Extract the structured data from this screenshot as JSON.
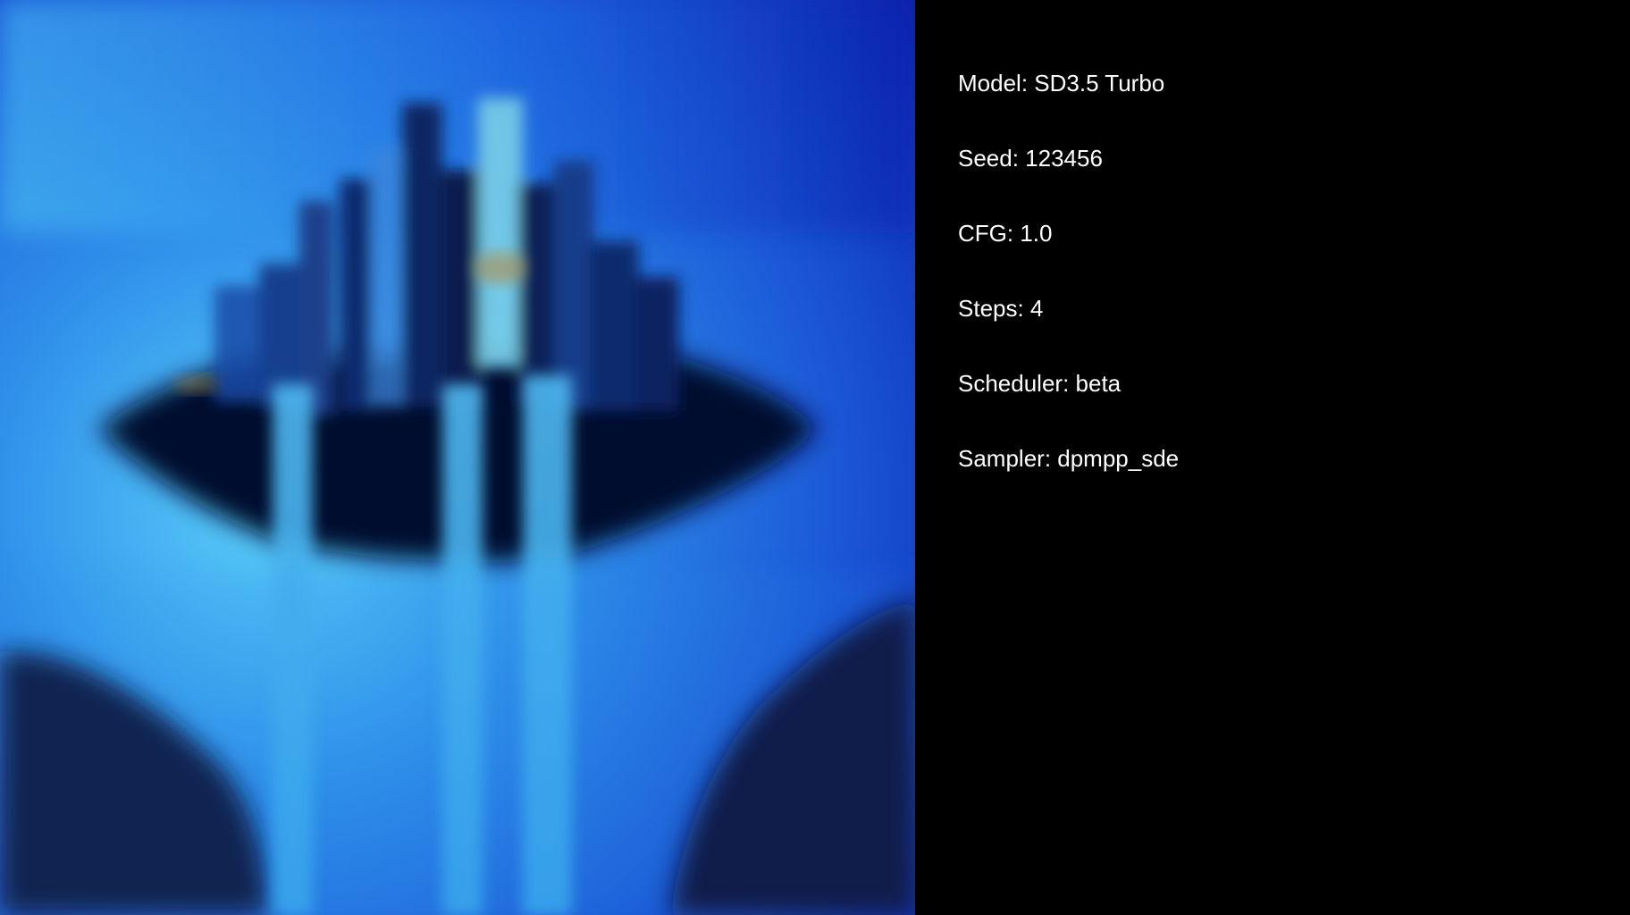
{
  "generated_image": {
    "alt": "Generated image"
  },
  "params": {
    "model": "Model: SD3.5 Turbo",
    "seed": "Seed: 123456",
    "cfg": "CFG: 1.0",
    "steps": "Steps: 4",
    "scheduler": "Scheduler: beta",
    "sampler": "Sampler: dpmpp_sde"
  },
  "colors": {
    "background": "#000000",
    "text": "#ffffff",
    "sky_light": "#4fc3f7",
    "sky_mid": "#1e6fe0",
    "sky_deep": "#0a1fa8",
    "silhouette": "#050a2e"
  }
}
